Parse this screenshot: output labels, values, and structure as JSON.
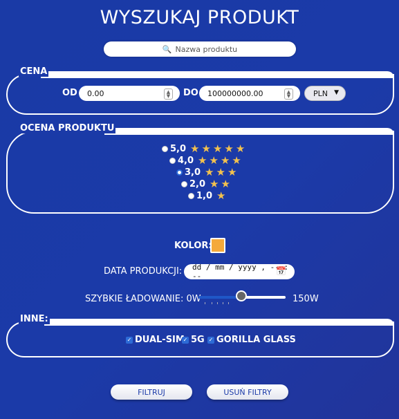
{
  "title": "WYSZUKAJ PRODUKT",
  "search": {
    "placeholder": "Nazwa produktu",
    "icon": "search-icon"
  },
  "price": {
    "legend": "CENA",
    "from_label": "OD",
    "from_value": "0.00",
    "to_label": "DO",
    "to_value": "100000000.00",
    "currency": "PLN"
  },
  "rating": {
    "legend": "OCENA PRODUKTU",
    "selected": "3,0",
    "options": [
      {
        "label": "5,0",
        "stars": 5
      },
      {
        "label": "4,0",
        "stars": 4
      },
      {
        "label": "3,0",
        "stars": 3
      },
      {
        "label": "2,0",
        "stars": 2
      },
      {
        "label": "1,0",
        "stars": 1
      }
    ]
  },
  "color": {
    "label": "KOLOR:",
    "value": "#f4a93b"
  },
  "date": {
    "label": "DATA PRODUKCJI:",
    "placeholder": "dd / mm / yyyy ,  -- : --"
  },
  "charging": {
    "label": "SZYBKIE ŁADOWANIE: 0W",
    "max_label": "150W",
    "value_fraction": 0.5
  },
  "other": {
    "legend": "INNE:",
    "options": [
      {
        "label": "DUAL-SIM",
        "checked": true
      },
      {
        "label": "5G",
        "checked": true
      },
      {
        "label": "GORILLA GLASS",
        "checked": true
      }
    ]
  },
  "buttons": {
    "filter": "FILTRUJ",
    "clear": "USUŃ FILTRY"
  }
}
